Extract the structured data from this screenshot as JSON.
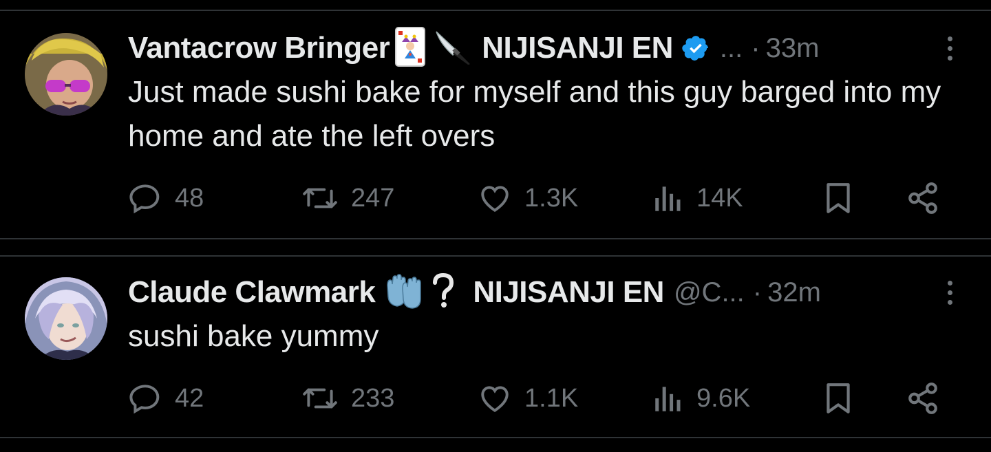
{
  "tweets": [
    {
      "author_name": "Vantacrow Bringer",
      "affiliation": "NIJISANJI EN",
      "handle": "...",
      "separator": "·",
      "time": "33m",
      "text": "Just made sushi bake for myself and this guy barged into my home and ate the left overs",
      "verified": true,
      "replies": "48",
      "reposts": "247",
      "likes": "1.3K",
      "views": "14K"
    },
    {
      "author_name": "Claude Clawmark",
      "affiliation": "NIJISANJI EN",
      "handle": "@C...",
      "separator": "·",
      "time": "32m",
      "text": "sushi bake yummy",
      "verified": false,
      "replies": "42",
      "reposts": "233",
      "likes": "1.1K",
      "views": "9.6K"
    }
  ],
  "colors": {
    "background": "#000000",
    "text_primary": "#e7e9ea",
    "text_secondary": "#71767b",
    "divider": "#2f3336",
    "verified_blue": "#1d9bf0"
  },
  "icons": [
    "joker-card-icon",
    "knife-icon",
    "verified-badge-icon",
    "gloves-icon",
    "question-mark-icon",
    "more-icon",
    "reply-icon",
    "repost-icon",
    "like-icon",
    "views-icon",
    "bookmark-icon",
    "share-icon"
  ]
}
